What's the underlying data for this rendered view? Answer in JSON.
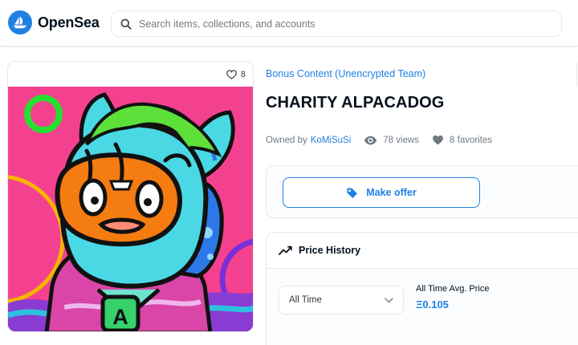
{
  "brand": {
    "name": "OpenSea",
    "color": "#2081e2"
  },
  "search": {
    "placeholder": "Search items, collections, and accounts",
    "icon": "search-icon"
  },
  "asset": {
    "favorites_count": "8",
    "collection": "Bonus Content (Unencrypted Team)",
    "title": "CHARITY ALPACADOG",
    "owned_by_label": "Owned by",
    "owner": "KoMiSuSi",
    "views": "78 views",
    "favorites": "8 favorites"
  },
  "offer": {
    "button_label": "Make offer",
    "icon": "tag-icon"
  },
  "price_history": {
    "title": "Price History",
    "timeframe": "All Time",
    "avg_label": "All Time Avg. Price",
    "avg_value": "Ξ0.105"
  }
}
